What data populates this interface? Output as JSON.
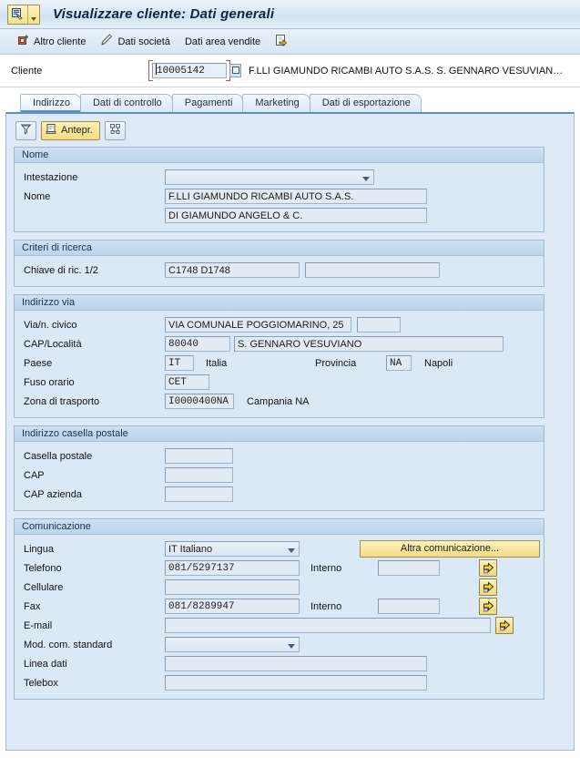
{
  "window": {
    "title": "Visualizzare cliente: Dati generali",
    "system_menu_icon": "sap-system-menu-icon"
  },
  "toolbar": {
    "items": [
      {
        "label": "Altro cliente",
        "icon": "other-customer-icon"
      },
      {
        "label": "Dati società",
        "icon": "pencil-icon"
      },
      {
        "label": "Dati area vendite",
        "icon": ""
      }
    ],
    "export_icon": "export-arrow-icon"
  },
  "client": {
    "label": "Cliente",
    "value": "10005142",
    "placeholder": "",
    "description": "F.LLI GIAMUNDO RICAMBI AUTO S.A.S.  S. GENNARO VESUVIAN…",
    "match_icon": "search-help-icon"
  },
  "tabs": [
    {
      "label": "Indirizzo",
      "active": true
    },
    {
      "label": "Dati di controllo",
      "active": false
    },
    {
      "label": "Pagamenti",
      "active": false
    },
    {
      "label": "Marketing",
      "active": false
    },
    {
      "label": "Dati di esportazione",
      "active": false
    }
  ],
  "inner_toolbar": {
    "filter_icon": "funnel-icon",
    "preview_label": "Antepr.",
    "preview_icon": "document-icon",
    "layout_icon": "layout-icon"
  },
  "sections": {
    "nome": {
      "title": "Nome",
      "intestazione_label": "Intestazione",
      "intestazione_value": "",
      "nome_label": "Nome",
      "nome_value": "F.LLI GIAMUNDO RICAMBI AUTO S.A.S.",
      "nome2_value": "DI GIAMUNDO ANGELO & C."
    },
    "criteri": {
      "title": "Criteri di ricerca",
      "chiave_label": "Chiave di ric. 1/2",
      "chiave1_value": "C1748 D1748",
      "chiave2_value": ""
    },
    "indirizzo_via": {
      "title": "Indirizzo via",
      "via_label": "Via/n. civico",
      "via_value": "VIA COMUNALE POGGIOMARINO, 25",
      "via_num_value": "",
      "cap_label": "CAP/Località",
      "cap_value": "80040",
      "localita_value": "S. GENNARO VESUVIANO",
      "paese_label": "Paese",
      "paese_value": "IT",
      "paese_text": "Italia",
      "provincia_label": "Provincia",
      "provincia_value": "NA",
      "provincia_text": "Napoli",
      "fuso_label": "Fuso orario",
      "fuso_value": "CET",
      "zona_label": "Zona di trasporto",
      "zona_value": "I0000400NA",
      "zona_text": "Campania NA"
    },
    "casella": {
      "title": "Indirizzo casella postale",
      "casella_label": "Casella postale",
      "casella_value": "",
      "cap_label": "CAP",
      "cap_value": "",
      "cap_azienda_label": "CAP azienda",
      "cap_azienda_value": ""
    },
    "comunicazione": {
      "title": "Comunicazione",
      "lingua_label": "Lingua",
      "lingua_value": "IT Italiano",
      "altra_button": "Altra comunicazione...",
      "telefono_label": "Telefono",
      "telefono_value": "081/5297137",
      "interno_label": "Interno",
      "telefono_interno_value": "",
      "cellulare_label": "Cellulare",
      "cellulare_value": "",
      "fax_label": "Fax",
      "fax_value": "081/8289947",
      "fax_interno_label": "Interno",
      "fax_interno_value": "",
      "email_label": "E-mail",
      "email_value": "",
      "mod_label": "Mod. com. standard",
      "mod_value": "",
      "linea_label": "Linea dati",
      "linea_value": "",
      "telebox_label": "Telebox",
      "telebox_value": ""
    }
  },
  "colors": {
    "accent": "#5b8fc9",
    "panel": "#dbe8f5",
    "field": "#e2eaf3",
    "button_yellow": "#f4dc84"
  }
}
